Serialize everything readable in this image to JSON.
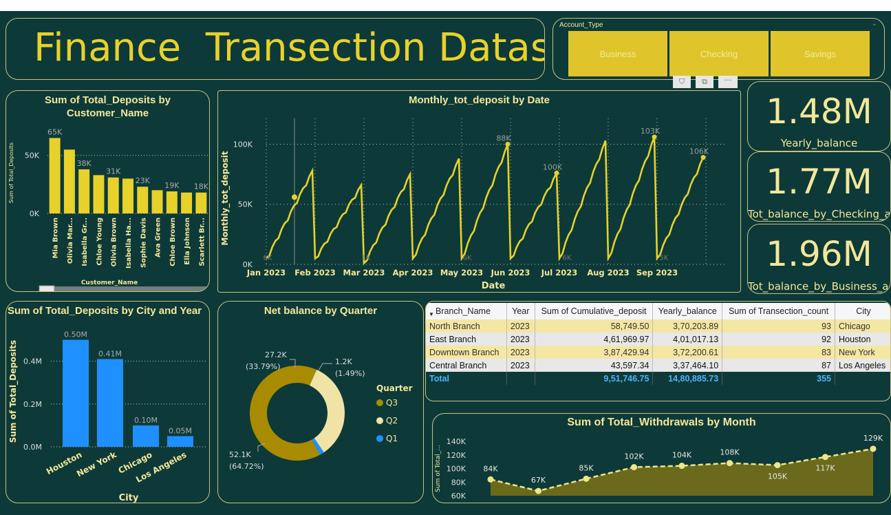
{
  "title": "Finance  Transection Dataset",
  "slicer": {
    "label": "Account_Type",
    "options": [
      "Business",
      "Checking",
      "Savings"
    ]
  },
  "kpis": [
    {
      "value": "1.48M",
      "label": "Yearly_balance"
    },
    {
      "value": "1.77M",
      "label": "Tot_balance_by_Checking_a..."
    },
    {
      "value": "1.96M",
      "label": "Tot_balance_by_Business_acc"
    }
  ],
  "colors": {
    "background": "#0d3a38",
    "accent": "#e8d12b",
    "blue": "#1e90ff",
    "olive": "#a88b00",
    "cream": "#efe3a6"
  },
  "chart_data": [
    {
      "type": "bar",
      "title": "Sum of Total_Deposits by Customer_Name",
      "xlabel": "Customer_Name",
      "ylabel": "Sum of Total_Deposits",
      "categories": [
        "Mia Brown",
        "Olivia Mar...",
        "Isabella Gr...",
        "Chloe Young",
        "Olivia Brown",
        "Isabella Ha...",
        "Sophie Davis",
        "Ava Green",
        "Chloe Brown",
        "Ella Johnson",
        "Scarlett Br..."
      ],
      "values": [
        65000,
        55000,
        38000,
        33000,
        31000,
        30000,
        23000,
        20000,
        19000,
        18000,
        18000
      ],
      "data_labels": [
        "65K",
        "",
        "38K",
        "",
        "31K",
        "",
        "23K",
        "",
        "19K",
        "",
        "18K"
      ],
      "yticks": [
        "0K",
        "50K"
      ],
      "ylim": [
        0,
        70000
      ]
    },
    {
      "type": "line",
      "title": "Monthly_tot_deposit by Date",
      "xlabel": "Date",
      "ylabel": "Monthly_tot_deposit",
      "x_ticks": [
        "Jan 2023",
        "Feb 2023",
        "Mar 2023",
        "Apr 2023",
        "May 2023",
        "Jun 2023",
        "Jul 2023",
        "Aug 2023",
        "Sep 2023"
      ],
      "yticks": [
        "0K",
        "50K",
        "100K"
      ],
      "ylim": [
        0,
        110000
      ],
      "series": [
        {
          "monthly_peaks": [
            78000,
            66000,
            75000,
            88000,
            100000,
            76000,
            103000,
            106000,
            89000
          ],
          "monthly_starts": [
            5000,
            5000,
            1000,
            5000,
            5000,
            5000,
            5000,
            5000,
            5000
          ]
        }
      ],
      "data_labels": [
        "6K",
        "",
        "1K",
        "",
        "88K",
        "100K",
        "5K",
        "103K",
        "106K",
        "89K"
      ],
      "peak_labels": [
        "",
        "",
        "",
        "",
        "88K",
        "100K",
        "",
        "103K",
        "106K",
        "89K"
      ]
    },
    {
      "type": "bar",
      "title": "Sum of Total_Deposits by City and Year",
      "xlabel": "City",
      "ylabel": "Sum of Total_Deposits",
      "categories": [
        "Houston",
        "New York",
        "Chicago",
        "Los Angeles"
      ],
      "values": [
        0.5,
        0.41,
        0.1,
        0.05
      ],
      "data_labels": [
        "0.50M",
        "0.41M",
        "0.10M",
        "0.05M"
      ],
      "yticks": [
        "0.0M",
        "0.2M",
        "0.4M"
      ],
      "ylim": [
        0,
        0.55
      ]
    },
    {
      "type": "pie",
      "title": "Net balance by Quarter",
      "legend_title": "Quarter",
      "legend": [
        "Q3",
        "Q2",
        "Q1"
      ],
      "slices": [
        {
          "name": "Q3",
          "value": 52100,
          "label": "52.1K",
          "pct": "(64.72%)"
        },
        {
          "name": "Q2",
          "value": 27200,
          "label": "27.2K",
          "pct": "(33.79%)"
        },
        {
          "name": "Q1",
          "value": 1200,
          "label": "1.2K",
          "pct": "(1.49%)"
        }
      ]
    },
    {
      "type": "table",
      "columns": [
        "Branch_Name",
        "Year",
        "Sum of Cumulative_deposit",
        "Yearly_balance",
        "Sum of Transection_count",
        "City"
      ],
      "rows": [
        [
          "North Branch",
          "2023",
          "58,749.50",
          "3,70,203.89",
          "93",
          "Chicago"
        ],
        [
          "East Branch",
          "2023",
          "4,61,969.97",
          "4,01,017.13",
          "92",
          "Houston"
        ],
        [
          "Downtown Branch",
          "2023",
          "3,87,429.94",
          "3,72,200.61",
          "83",
          "New York"
        ],
        [
          "Central Branch",
          "2023",
          "43,597.34",
          "3,37,464.10",
          "87",
          "Los Angeles"
        ]
      ],
      "total": [
        "Total",
        "",
        "9,51,746.75",
        "14,80,885.73",
        "355",
        ""
      ]
    },
    {
      "type": "area",
      "title": "Sum of Total_Withdrawals by Month",
      "ylabel": "Sum of Total_...",
      "values": [
        84,
        67,
        85,
        102,
        104,
        108,
        105,
        117,
        129
      ],
      "data_labels": [
        "84K",
        "67K",
        "85K",
        "102K",
        "104K",
        "108K",
        "105K",
        "117K",
        "129K"
      ],
      "yticks": [
        "60K",
        "80K",
        "100K",
        "120K",
        "140K"
      ],
      "ylim": [
        60,
        140
      ]
    }
  ]
}
